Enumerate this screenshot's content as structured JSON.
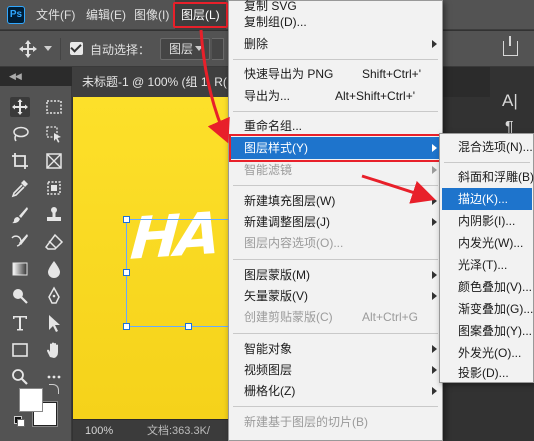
{
  "menubar": {
    "app_logo": "Ps",
    "items": [
      "文件(F)",
      "编辑(E)",
      "图像(I)",
      "图层(L)"
    ]
  },
  "options_bar": {
    "auto_select_label": "自动选择：",
    "auto_select_checked": true,
    "target_value": "图层"
  },
  "document": {
    "tab_title": "未标题-1 @ 100% (组 1, R(",
    "canvas_text": "HA"
  },
  "status": {
    "zoom": "100%",
    "doc_info": "文档:363.3K/"
  },
  "layer_menu": {
    "items": [
      {
        "label": "复制 SVG",
        "shortcut": "",
        "submenu": false,
        "disabled": false
      },
      {
        "label": "复制组(D)...",
        "shortcut": "",
        "submenu": false,
        "disabled": false
      },
      {
        "label": "删除",
        "shortcut": "",
        "submenu": true,
        "disabled": false
      },
      {
        "label": "快速导出为 PNG",
        "shortcut": "Shift+Ctrl+'",
        "submenu": false,
        "disabled": false
      },
      {
        "label": "导出为...",
        "shortcut": "Alt+Shift+Ctrl+'",
        "submenu": false,
        "disabled": false
      },
      {
        "label": "重命名组...",
        "shortcut": "",
        "submenu": false,
        "disabled": false
      },
      {
        "label": "图层样式(Y)",
        "shortcut": "",
        "submenu": true,
        "disabled": false,
        "highlighted": true
      },
      {
        "label": "智能滤镜",
        "shortcut": "",
        "submenu": true,
        "disabled": true
      },
      {
        "label": "新建填充图层(W)",
        "shortcut": "",
        "submenu": true,
        "disabled": false
      },
      {
        "label": "新建调整图层(J)",
        "shortcut": "",
        "submenu": true,
        "disabled": false
      },
      {
        "label": "图层内容选项(O)...",
        "shortcut": "",
        "submenu": false,
        "disabled": true
      },
      {
        "label": "图层蒙版(M)",
        "shortcut": "",
        "submenu": true,
        "disabled": false
      },
      {
        "label": "矢量蒙版(V)",
        "shortcut": "",
        "submenu": true,
        "disabled": false
      },
      {
        "label": "创建剪贴蒙版(C)",
        "shortcut": "Alt+Ctrl+G",
        "submenu": false,
        "disabled": true
      },
      {
        "label": "智能对象",
        "shortcut": "",
        "submenu": true,
        "disabled": false
      },
      {
        "label": "视频图层",
        "shortcut": "",
        "submenu": true,
        "disabled": false
      },
      {
        "label": "栅格化(Z)",
        "shortcut": "",
        "submenu": true,
        "disabled": false
      },
      {
        "label": "新建基于图层的切片(B)",
        "shortcut": "",
        "submenu": false,
        "disabled": true
      }
    ]
  },
  "layer_style_submenu": {
    "items": [
      {
        "label": "混合选项(N)..."
      },
      {
        "label": "斜面和浮雕(B)..."
      },
      {
        "label": "描边(K)...",
        "highlighted": true
      },
      {
        "label": "内阴影(I)..."
      },
      {
        "label": "内发光(W)..."
      },
      {
        "label": "光泽(T)..."
      },
      {
        "label": "颜色叠加(V)..."
      },
      {
        "label": "渐变叠加(G)..."
      },
      {
        "label": "图案叠加(Y)..."
      },
      {
        "label": "外发光(O)..."
      },
      {
        "label": "投影(D)..."
      }
    ]
  },
  "colors": {
    "highlight": "#1e74cc",
    "annotation_red": "#e8202a",
    "canvas_yellow": "#fde02a"
  }
}
